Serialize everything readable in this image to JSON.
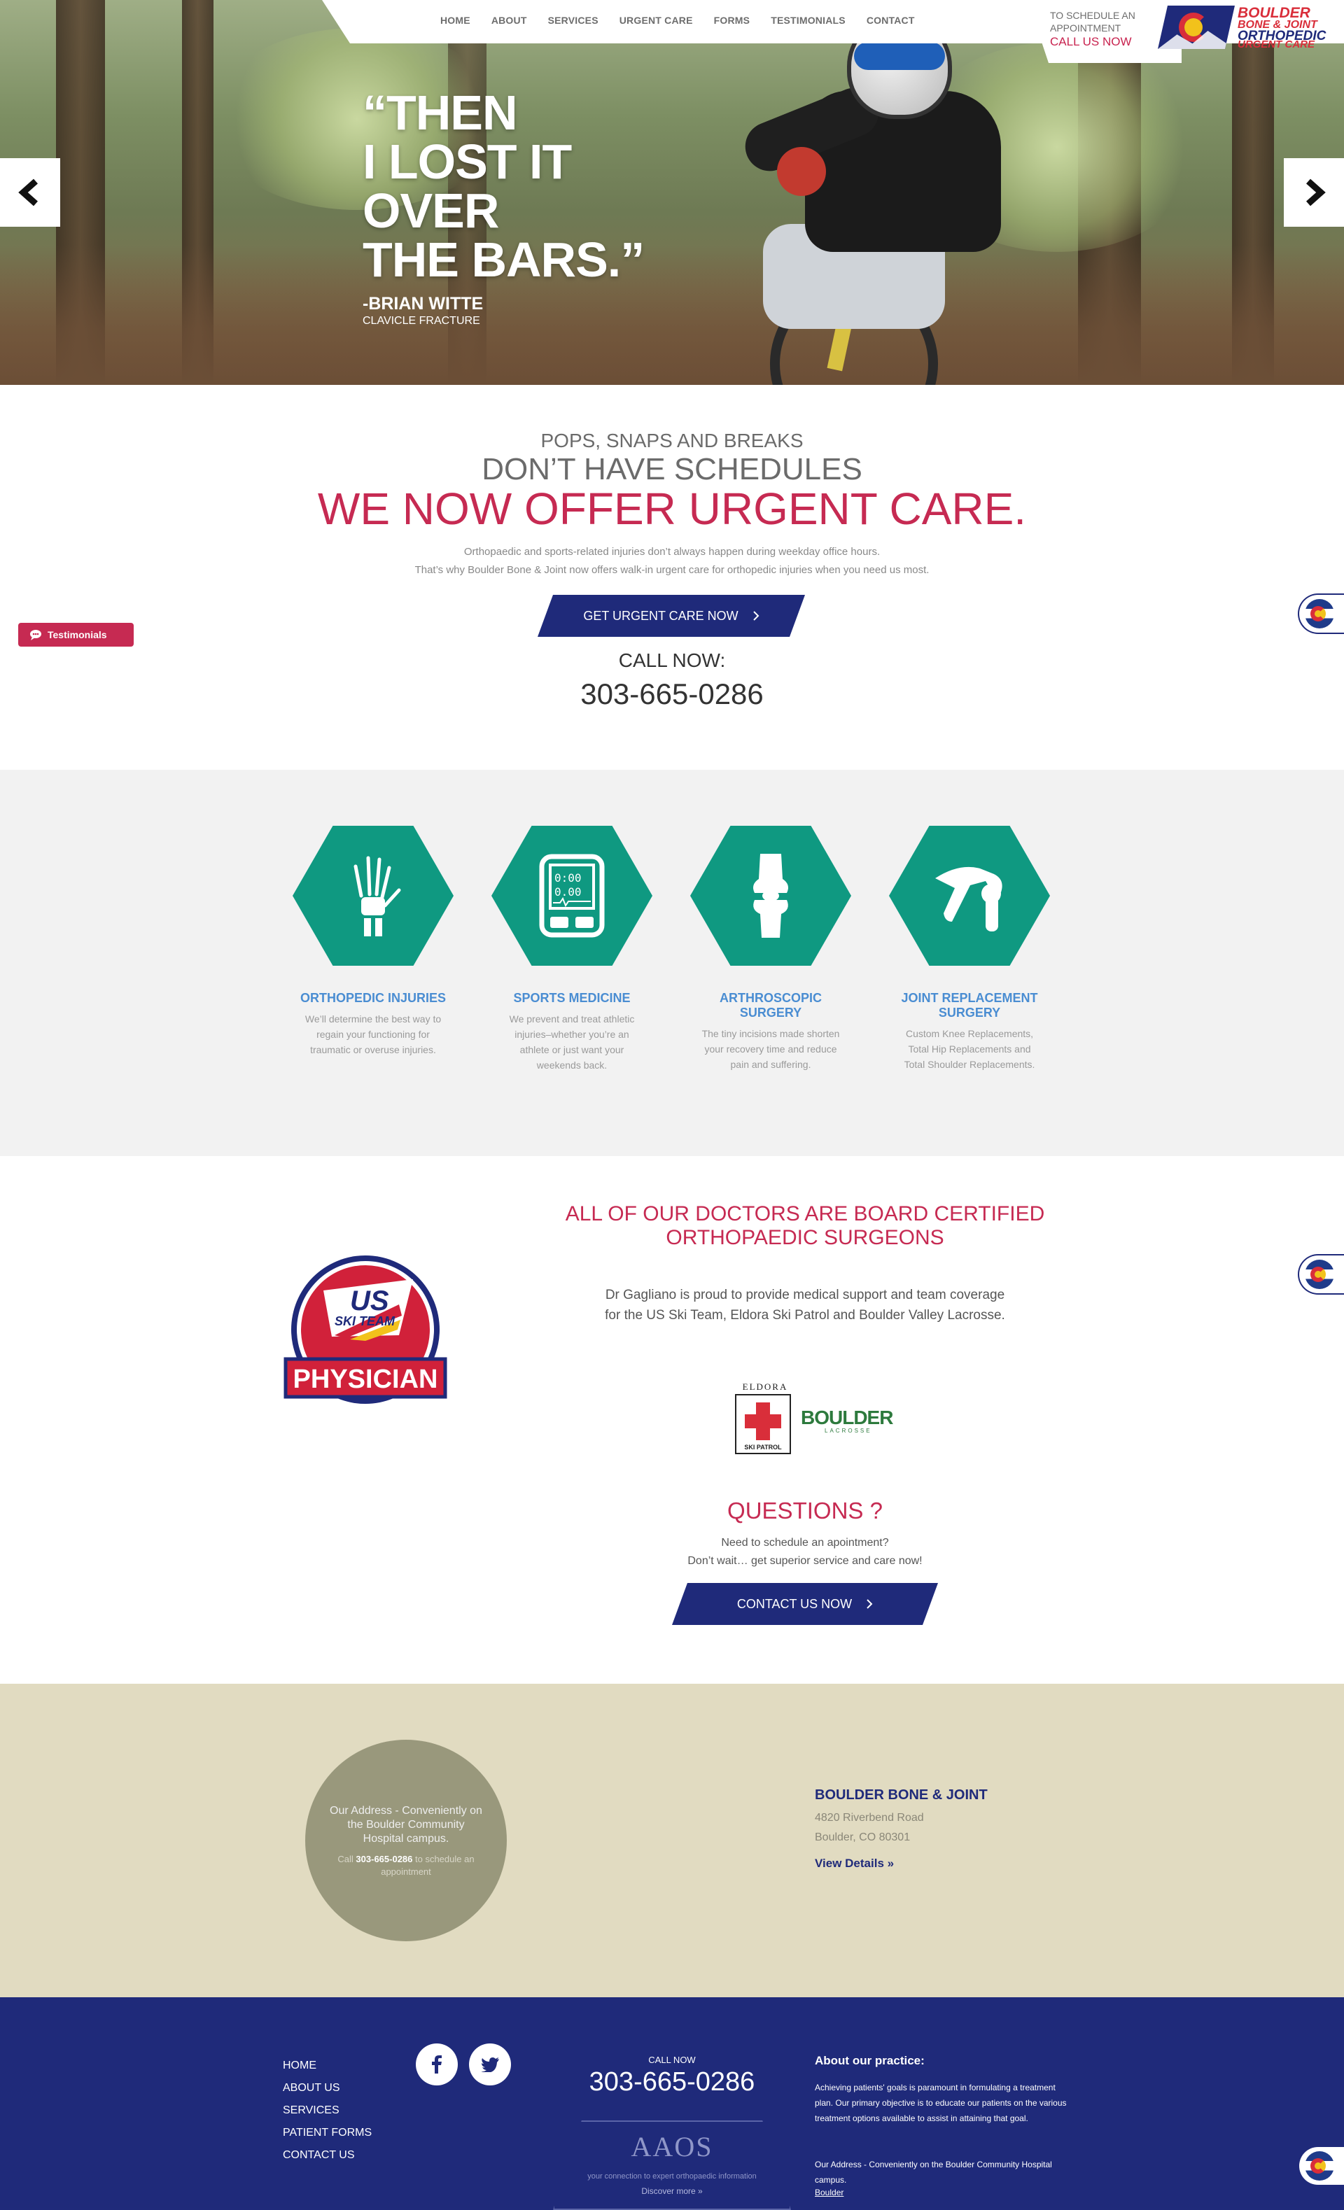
{
  "nav": {
    "items": [
      "HOME",
      "ABOUT",
      "SERVICES",
      "URGENT CARE",
      "FORMS",
      "TESTIMONIALS",
      "CONTACT"
    ]
  },
  "header": {
    "schedule_line1": "TO SCHEDULE AN",
    "schedule_line2": "APPOINTMENT",
    "schedule_cta": "CALL US NOW",
    "logo_line1": "BOULDER",
    "logo_line2": "BONE & JOINT",
    "logo_line3": "ORTHOPEDIC",
    "logo_line4": "URGENT CARE"
  },
  "hero": {
    "quote_lines": [
      "“THEN",
      "I LOST IT",
      "OVER",
      "THE BARS.”"
    ],
    "author": "-BRIAN WITTE",
    "injury": "CLAVICLE FRACTURE",
    "prev_icon": "chevron-left-icon",
    "next_icon": "chevron-right-icon"
  },
  "urgent_care": {
    "kicker": "POPS, SNAPS AND BREAKS",
    "subtitle": "DON’T HAVE SCHEDULES",
    "title": "WE NOW OFFER URGENT CARE.",
    "desc_line1": "Orthopaedic and sports-related injuries don’t always happen during weekday office hours.",
    "desc_line2": "That’s why Boulder Bone & Joint now offers walk-in urgent care for orthopedic injuries when you need us most.",
    "button": "GET URGENT CARE NOW",
    "call_label": "CALL NOW:",
    "phone": "303-665-0286"
  },
  "testimonials_tab": "Testimonials",
  "services": [
    {
      "title": "ORTHOPEDIC INJURIES",
      "desc": "We’ll determine the best way to regain your functioning for traumatic or overuse injuries.",
      "icon": "hand-bones-icon"
    },
    {
      "title": "SPORTS MEDICINE",
      "desc": "We prevent and treat athletic injuries–whether you’re an athlete or just want your weekends back.",
      "icon": "fitness-monitor-icon"
    },
    {
      "title": "ARTHROSCOPIC SURGERY",
      "desc": "The tiny incisions made shorten your recovery time and reduce pain and suffering.",
      "icon": "knee-joint-icon"
    },
    {
      "title": "JOINT REPLACEMENT SURGERY",
      "desc": "Custom Knee Replacements, Total Hip Replacements and Total Shoulder Replacements.",
      "icon": "shoulder-joint-icon"
    }
  ],
  "doctors": {
    "title_line1": "ALL OF OUR DOCTORS ARE BOARD CERTIFIED",
    "title_line2": "ORTHOPAEDIC SURGEONS",
    "desc": "Dr Gagliano is proud to provide medical support and team coverage for the US Ski Team, Eldora Ski Patrol and Boulder Valley Lacrosse.",
    "badge_us": "US",
    "badge_ski": "SKI TEAM",
    "badge_physician": "PHYSICIAN",
    "eldora_label": "ELDORA",
    "eldora_patrol": "SKI PATROL",
    "lacrosse_name": "BOULDER",
    "lacrosse_sub": "LACROSSE"
  },
  "questions": {
    "title": "QUESTIONS ?",
    "line1": "Need to schedule an apointment?",
    "line2": "Don’t wait… get superior service and care now!",
    "button": "CONTACT US NOW"
  },
  "location": {
    "circle_line1": "Our Address - Conveniently on the Boulder Community Hospital campus.",
    "circle_pre": "Call ",
    "circle_phone": "303-665-0286",
    "circle_post": " to schedule an appointment",
    "name": "BOULDER BONE & JOINT",
    "addr1": "4820 Riverbend Road",
    "addr2": "Boulder, CO 80301",
    "link": "View Details »"
  },
  "footer": {
    "links": [
      "HOME",
      "ABOUT US",
      "SERVICES",
      "PATIENT FORMS",
      "CONTACT US"
    ],
    "call_label": "CALL NOW",
    "phone": "303-665-0286",
    "aaos": "AAOS",
    "aaos_tag": "your connection to expert orthopaedic information",
    "aaos_more": "Discover more »",
    "about_title": "About our practice:",
    "about_text": "Achieving patients' goals is paramount in formulating a treatment plan. Our primary objective is to educate our patients on the various treatment options available to assist in attaining that goal.",
    "about_addr": "Our Address - Conveniently on the Boulder Community Hospital campus.",
    "boulder_link": "Boulder"
  },
  "colors": {
    "brand_blue": "#1f2a7a",
    "brand_red": "#c62a52",
    "service_teal": "#0f9981",
    "service_title_blue": "#4a8dd2",
    "location_bg": "#e1dbc1"
  }
}
